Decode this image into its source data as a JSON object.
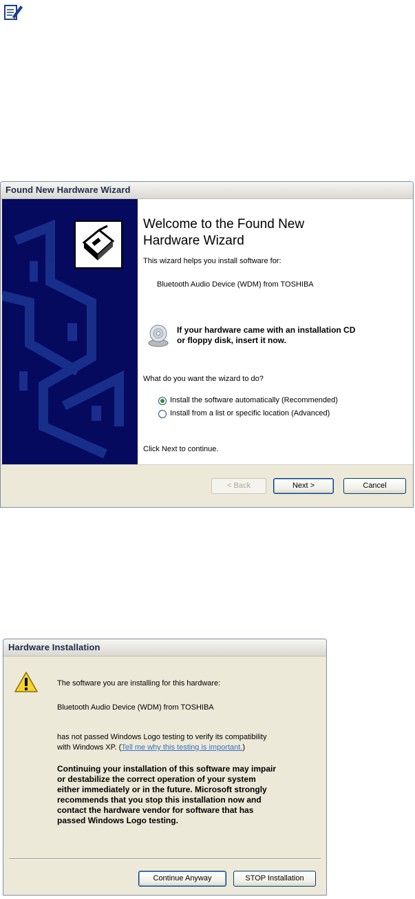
{
  "note_icon": "note-pencil-icon",
  "wizard": {
    "title": "Found New Hardware Wizard",
    "heading_line1": "Welcome to the Found New",
    "heading_line2": "Hardware Wizard",
    "intro": "This wizard helps you install software for:",
    "device": "Bluetooth Audio Device (WDM) from TOSHIBA",
    "cd_line1": "If your hardware came with an installation CD",
    "cd_line2": "or floppy disk, insert it now.",
    "question": "What do you want the wizard to do?",
    "options": [
      {
        "label": "Install the software automatically (Recommended)",
        "selected": true
      },
      {
        "label": "Install from a list or specific location (Advanced)",
        "selected": false
      }
    ],
    "continue_text": "Click Next to continue.",
    "buttons": {
      "back": "< Back",
      "next": "Next >",
      "cancel": "Cancel"
    }
  },
  "hardware_installation": {
    "title": "Hardware Installation",
    "line1": "The software you are installing for this hardware:",
    "device": "Bluetooth Audio Device (WDM) from TOSHIBA",
    "line2a": "has not passed Windows Logo testing to verify its compatibility",
    "line2b": "with Windows XP. (",
    "link": "Tell me why this testing is important.",
    "line2c": ")",
    "warning_lines": [
      "Continuing your installation of this software may impair",
      "or destabilize the correct operation of your system",
      "either immediately or in the future. Microsoft strongly",
      "recommends that you stop this installation now and",
      "contact the hardware vendor for software that has",
      "passed Windows Logo testing."
    ],
    "buttons": {
      "continue": "Continue Anyway",
      "stop": "STOP Installation"
    }
  }
}
